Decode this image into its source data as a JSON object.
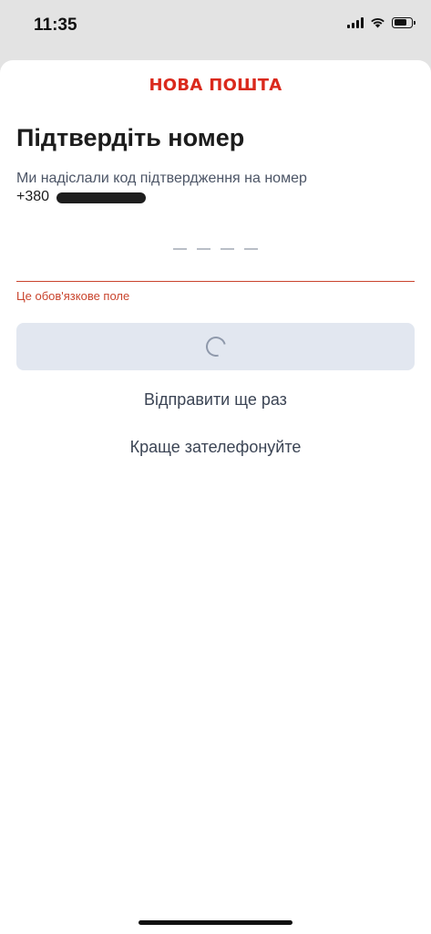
{
  "status_bar": {
    "time": "11:35",
    "icons": [
      "cellular-signal-icon",
      "wifi-icon",
      "battery-icon"
    ]
  },
  "brand": {
    "logo_text": "НОВА ПОШТА",
    "accent_color": "#da291c"
  },
  "verify": {
    "title": "Підтвердіть номер",
    "subtitle": "Ми надіслали код підтвердження на номер",
    "phone_prefix": "+380",
    "code_length": 4,
    "error": "Це обов'язкове поле",
    "submit_state": "loading"
  },
  "actions": {
    "resend_label": "Відправити ще раз",
    "call_label": "Краще зателефонуйте"
  },
  "colors": {
    "error": "#c9442d",
    "button_bg": "#e2e7f0",
    "text_secondary": "#4c5566"
  }
}
